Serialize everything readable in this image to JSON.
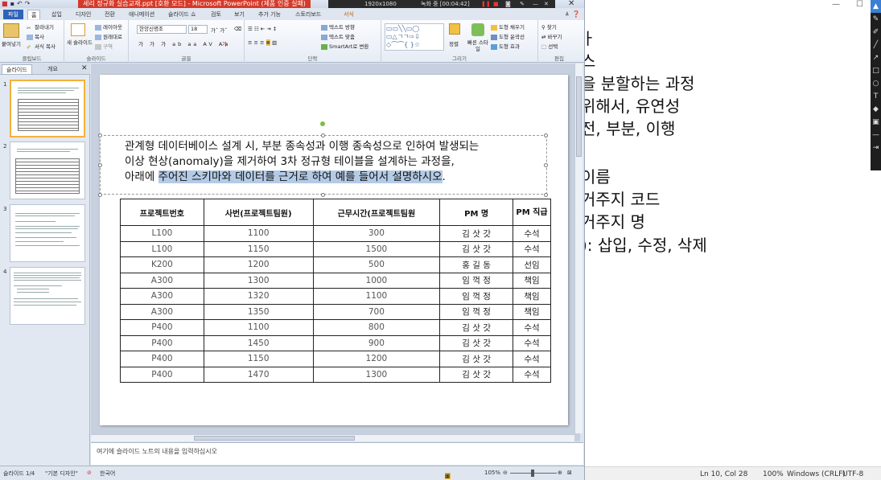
{
  "background_editor": {
    "lines": [
      "ㅏ",
      "스",
      "을 분할하는 과정",
      "위해서, 유연성",
      "전, 부분, 이행",
      "이름",
      "거주지 코드",
      "거주지 명",
      "): 삽입, 수정, 삭제"
    ],
    "status": {
      "position": "Ln 10, Col 28",
      "zoom": "100%",
      "line_ending": "Windows (CRLF)",
      "encoding": "UTF-8"
    },
    "window_buttons": [
      "—",
      "☐"
    ]
  },
  "powerpoint": {
    "title": "세리 정규화 실습교재.ppt [호환 모드] - Microsoft PowerPoint (제품 인증 실패)",
    "recorder": {
      "resolution": "1920x1080",
      "status": "녹화 중 [00:04:42]"
    },
    "tabs": [
      "파일",
      "홈",
      "삽입",
      "디자인",
      "전환",
      "애니메이션",
      "슬라이드 쇼",
      "검토",
      "보기",
      "추가 기능",
      "스토리보드",
      "서식"
    ],
    "ribbon": {
      "clipboard": {
        "label": "클립보드",
        "paste": "붙여넣기",
        "cut": "잘라내기",
        "copy": "복사",
        "format_painter": "서식 복사"
      },
      "slides": {
        "label": "슬라이드",
        "new_slide": "새 슬라이드",
        "layout": "레이아웃",
        "reset": "원래대로",
        "section": "구역"
      },
      "font": {
        "label": "글꼴",
        "font_name": "한양신명조",
        "font_size": "18"
      },
      "paragraph": {
        "label": "단락",
        "text_direction": "텍스트 방향",
        "align_text": "텍스트 맞춤",
        "smartart": "SmartArt로 변환"
      },
      "drawing": {
        "label": "그리기",
        "arrange": "정렬",
        "quick_styles": "빠른 스타일",
        "shape_fill": "도형 채우기",
        "shape_outline": "도형 윤곽선",
        "shape_effects": "도형 효과"
      },
      "editing": {
        "label": "편집",
        "find": "찾기",
        "replace": "바꾸기",
        "select": "선택"
      }
    },
    "panel_tabs": [
      "슬라이드",
      "개요"
    ],
    "slide_numbers": [
      "1",
      "2",
      "3",
      "4"
    ],
    "slide": {
      "question_line1": "관계형 데이터베이스 설계 시, 부분 종속성과 이행 종속성으로 인하여 발생되는",
      "question_line2": "이상 현상(anomaly)을 제거하여 3차 정규형 테이블을 설계하는 과정을,",
      "question_line3a": "아래에 ",
      "question_line3b": "주어진 스키마와 데이터를 근거로 하여 예를 들어서 설명하시오",
      "question_line3c": ".",
      "table": {
        "headers": [
          "프로젝트번호",
          "사번(프로젝트팀원)",
          "근무시간(프로젝트팀원",
          "PM 명",
          "PM 직급"
        ],
        "rows": [
          [
            "L100",
            "1100",
            "300",
            "김 삿 갓",
            "수석"
          ],
          [
            "L100",
            "1150",
            "1500",
            "김 삿 갓",
            "수석"
          ],
          [
            "K200",
            "1200",
            "500",
            "홍 길 동",
            "선임"
          ],
          [
            "A300",
            "1300",
            "1000",
            "임 꺽 정",
            "책임"
          ],
          [
            "A300",
            "1320",
            "1100",
            "임 꺽 정",
            "책임"
          ],
          [
            "A300",
            "1350",
            "700",
            "임 꺽 정",
            "책임"
          ],
          [
            "P400",
            "1100",
            "800",
            "김 삿 갓",
            "수석"
          ],
          [
            "P400",
            "1450",
            "900",
            "김 삿 갓",
            "수석"
          ],
          [
            "P400",
            "1150",
            "1200",
            "김 삿 갓",
            "수석"
          ],
          [
            "P400",
            "1470",
            "1300",
            "김 삿 갓",
            "수석"
          ]
        ]
      }
    },
    "notes_placeholder": "여기에 슬라이드 노트의 내용을 입력하십시오",
    "status": {
      "slide_position": "슬라이드 1/4",
      "theme": "\"기본 디자인\"",
      "language": "한국어",
      "zoom": "105%"
    }
  }
}
